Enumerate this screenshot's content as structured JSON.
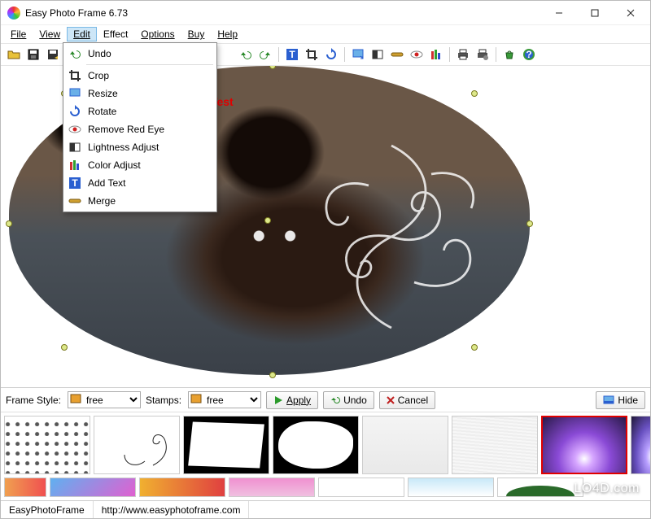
{
  "window": {
    "title": "Easy Photo Frame 6.73"
  },
  "menu": {
    "file": "File",
    "view": "View",
    "edit": "Edit",
    "effect": "Effect",
    "options": "Options",
    "buy": "Buy",
    "help": "Help"
  },
  "edit_menu": {
    "undo": "Undo",
    "crop": "Crop",
    "resize": "Resize",
    "rotate": "Rotate",
    "remove_red_eye": "Remove Red Eye",
    "lightness_adjust": "Lightness Adjust",
    "color_adjust": "Color Adjust",
    "add_text": "Add Text",
    "merge": "Merge"
  },
  "canvas": {
    "text_overlay": "m Text Test"
  },
  "controls": {
    "frame_style_label": "Frame Style:",
    "frame_style_value": "free",
    "stamps_label": "Stamps:",
    "stamps_value": "free",
    "apply": "Apply",
    "undo": "Undo",
    "cancel": "Cancel",
    "hide": "Hide"
  },
  "status": {
    "app": "EasyPhotoFrame",
    "url": "http://www.easyphotoframe.com"
  },
  "watermark": "LO4D.com"
}
